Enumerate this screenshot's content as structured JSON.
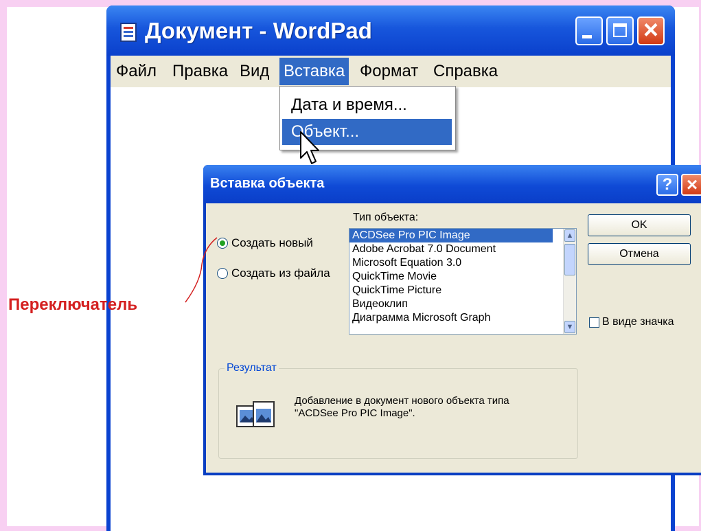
{
  "wordpad": {
    "title": "Документ - WordPad",
    "menu": [
      "Файл",
      "Правка",
      "Вид",
      "Вставка",
      "Формат",
      "Справка"
    ],
    "active_menu": "Вставка"
  },
  "insert_menu": {
    "items": [
      "Дата и время...",
      "Объект..."
    ],
    "highlighted": "Объект..."
  },
  "insert_object_dialog": {
    "title": "Вставка объекта",
    "help_label": "?",
    "close_label": "×",
    "radio_create_new": "Создать новый",
    "radio_create_from_file": "Создать из файла",
    "selected_radio": "Создать новый",
    "object_type_label": "Тип объекта:",
    "object_types": [
      "ACDSee Pro PIC Image",
      "Adobe Acrobat 7.0 Document",
      "Microsoft Equation 3.0",
      "QuickTime Movie",
      "QuickTime Picture",
      "Видеоклип",
      "Диаграмма Microsoft Graph"
    ],
    "selected_type": "ACDSee Pro PIC Image",
    "ok_label": "OK",
    "cancel_label": "Отмена",
    "as_icon_label": "В виде значка",
    "as_icon_checked": false,
    "result_label": "Результат",
    "result_line1": "Добавление в документ нового объекта типа",
    "result_line2": "\"ACDSee Pro PIC Image\"."
  },
  "annotation": {
    "text": "Переключатель"
  },
  "colors": {
    "titlebar_blue": "#0a42d0",
    "selection_blue": "#316ac5",
    "dialog_face": "#ece9d8",
    "annotation_red": "#d42020",
    "background_pink": "#f8d0f2"
  },
  "icons": {
    "app_icon": "wordpad-document-icon",
    "minimize": "minimize-icon",
    "maximize": "maximize-icon",
    "close": "close-icon",
    "cursor": "mouse-pointer-icon",
    "result": "object-images-icon"
  }
}
